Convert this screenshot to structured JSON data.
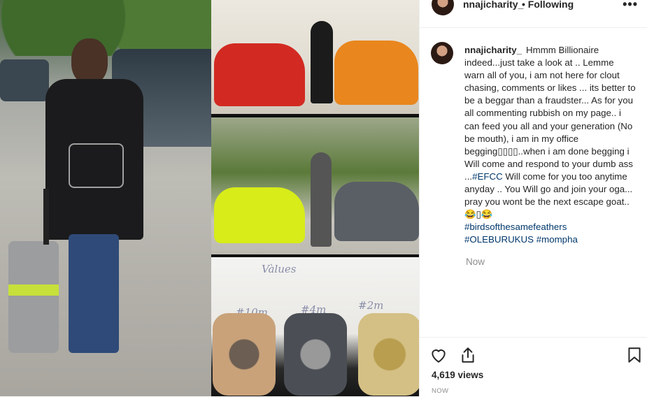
{
  "header": {
    "username": "nnajicharity_",
    "separator": "•",
    "follow_status": "Following",
    "more_icon": "more-dots-icon"
  },
  "caption": {
    "username": "nnajicharity_",
    "text_1": "Hmmm Billionaire indeed...just take a look at .. Lemme warn all of you, i am not here for clout chasing, comments or likes ... its better to be a beggar than a fraudster... As for you all commenting rubbish on my page.. i can feed you all and your generation (No be mouth), i am in my office begging▯▯▯▯..when i am done begging i Will come and respond to your dumb ass ...",
    "mention": "#EFCC",
    "text_2": " Will come for you too anytime anyday .. You Will go and join your oga... pray you wont be the next escape goat..😂▯😂",
    "hashtags": [
      "#birdsofthesamefeathers",
      "#OLEBURUKUS",
      "#mompha"
    ],
    "time": "Now"
  },
  "media": {
    "paper_title": "Vàlues",
    "price_labels": [
      "#10m",
      "#4m",
      "#2m"
    ]
  },
  "actions": {
    "like_icon": "heart-icon",
    "share_icon": "share-icon",
    "save_icon": "bookmark-icon"
  },
  "stats": {
    "views": "4,619 views",
    "posted": "NOW"
  },
  "colors": {
    "text": "#262626",
    "muted": "#8e8e8e",
    "link": "#00376b",
    "border": "#efefef"
  }
}
